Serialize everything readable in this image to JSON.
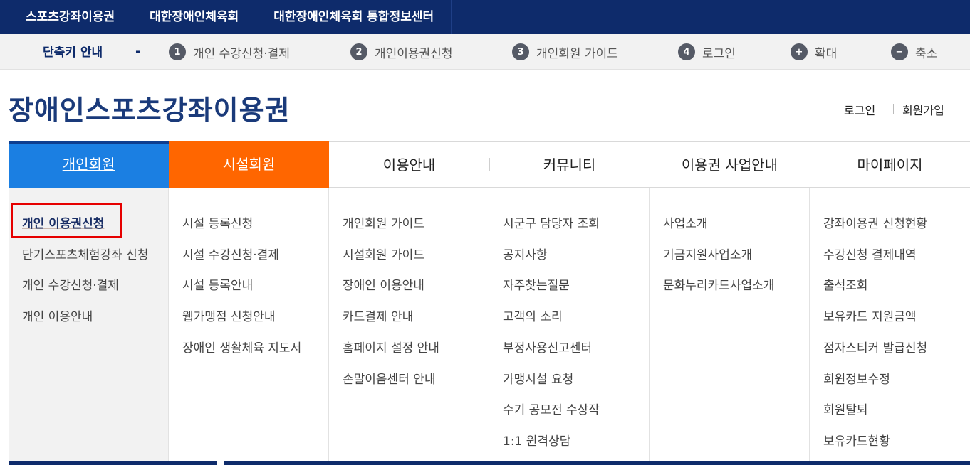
{
  "topbar": {
    "links": [
      "스포츠강좌이용권",
      "대한장애인체육회",
      "대한장애인체육회 통합정보센터"
    ]
  },
  "shortcuts": {
    "title": "단축키 안내",
    "dash": "-",
    "items": [
      {
        "badge": "1",
        "label": "개인 수강신청·결제"
      },
      {
        "badge": "2",
        "label": "개인이용권신청"
      },
      {
        "badge": "3",
        "label": "개인회원 가이드"
      },
      {
        "badge": "4",
        "label": "로그인"
      },
      {
        "badge": "+",
        "label": "확대"
      },
      {
        "badge": "−",
        "label": "축소"
      }
    ]
  },
  "header": {
    "logo": "장애인스포츠강좌이용권",
    "login": "로그인",
    "signup": "회원가입"
  },
  "gnb": [
    {
      "label": "개인회원"
    },
    {
      "label": "시설회원"
    },
    {
      "label": "이용안내"
    },
    {
      "label": "커뮤니티"
    },
    {
      "label": "이용권 사업안내"
    },
    {
      "label": "마이페이지"
    }
  ],
  "mega": [
    [
      "개인 이용권신청",
      "단기스포츠체험강좌 신청",
      "개인 수강신청·결제",
      "개인 이용안내"
    ],
    [
      "시설 등록신청",
      "시설 수강신청·결제",
      "시설 등록안내",
      "웹가맹점 신청안내",
      "장애인 생활체육 지도서"
    ],
    [
      "개인회원 가이드",
      "시설회원 가이드",
      "장애인 이용안내",
      "카드결제 안내",
      "홈페이지 설정 안내",
      "손말이음센터 안내"
    ],
    [
      "시군구 담당자 조회",
      "공지사항",
      "자주찾는질문",
      "고객의 소리",
      "부정사용신고센터",
      "가맹시설 요청",
      "수기 공모전 수상작",
      "1:1 원격상담"
    ],
    [
      "사업소개",
      "기금지원사업소개",
      "문화누리카드사업소개"
    ],
    [
      "강좌이용권 신청현황",
      "수강신청 결제내역",
      "출석조회",
      "보유카드 지원금액",
      "점자스티커 발급신청",
      "회원정보수정",
      "회원탈퇴",
      "보유카드현황"
    ]
  ],
  "colors": {
    "navy": "#0e2b6b",
    "active_blue": "#1b7fe2",
    "orange": "#ff6600",
    "highlight_red": "#e60000"
  }
}
